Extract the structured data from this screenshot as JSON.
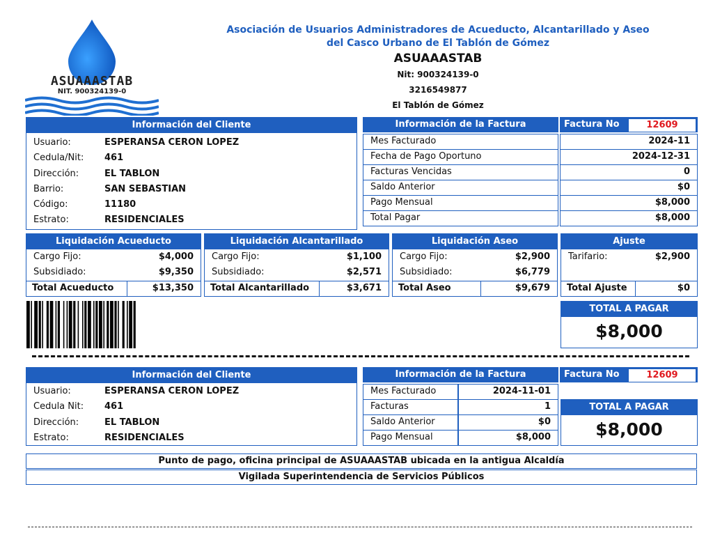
{
  "logo": {
    "name": "ASUAAASTAB",
    "nit": "NIT. 900324139-0"
  },
  "header": {
    "line1": "Asociación de Usuarios Administradores de Acueducto, Alcantarillado y Aseo",
    "line2": "del Casco Urbano de El Tablón de Gómez",
    "name": "ASUAAASTAB",
    "nit": "Nit: 900324139-0",
    "phone": "3216549877",
    "city": "El Tablón de Gómez"
  },
  "client": {
    "title": "Información del Cliente",
    "rows": [
      {
        "k": "Usuario:",
        "v": "ESPERANSA CERON LOPEZ"
      },
      {
        "k": "Cedula/Nit:",
        "v": "461"
      },
      {
        "k": "Dirección:",
        "v": "EL TABLON"
      },
      {
        "k": "Barrio:",
        "v": "SAN SEBASTIAN"
      },
      {
        "k": "Código:",
        "v": "11180"
      },
      {
        "k": "Estrato:",
        "v": "RESIDENCIALES"
      }
    ]
  },
  "invoice": {
    "title": "Información de la Factura",
    "no_label": "Factura No",
    "no_value": "12609",
    "rows": [
      {
        "k": "Mes Facturado",
        "v": "2024-11"
      },
      {
        "k": "Fecha de Pago Oportuno",
        "v": "2024-12-31"
      },
      {
        "k": "Facturas Vencidas",
        "v": "0"
      },
      {
        "k": "Saldo Anterior",
        "v": "$0"
      },
      {
        "k": "Pago Mensual",
        "v": "$8,000"
      },
      {
        "k": "Total Pagar",
        "v": "$8,000"
      }
    ]
  },
  "liq": [
    {
      "title": "Liquidación Acueducto",
      "rows": [
        {
          "k": "Cargo Fijo:",
          "v": "$4,000"
        },
        {
          "k": "Subsidiado:",
          "v": "$9,350"
        }
      ],
      "total_k": "Total Acueducto",
      "total_v": "$13,350"
    },
    {
      "title": "Liquidación Alcantarillado",
      "rows": [
        {
          "k": "Cargo Fijo:",
          "v": "$1,100"
        },
        {
          "k": "Subsidiado:",
          "v": "$2,571"
        }
      ],
      "total_k": "Total Alcantarillado",
      "total_v": "$3,671"
    },
    {
      "title": "Liquidación Aseo",
      "rows": [
        {
          "k": "Cargo Fijo:",
          "v": "$2,900"
        },
        {
          "k": "Subsidiado:",
          "v": "$6,779"
        }
      ],
      "total_k": "Total Aseo",
      "total_v": "$9,679"
    },
    {
      "title": "Ajuste",
      "rows": [
        {
          "k": "Tarifario:",
          "v": "$2,900"
        }
      ],
      "total_k": "Total Ajuste",
      "total_v": "$0"
    }
  ],
  "total": {
    "label": "TOTAL A PAGAR",
    "value": "$8,000"
  },
  "stub": {
    "client_title": "Información del Cliente",
    "client_rows": [
      {
        "k": "Usuario:",
        "v": "ESPERANSA CERON LOPEZ"
      },
      {
        "k": "Cedula Nit:",
        "v": "461"
      },
      {
        "k": "Dirección:",
        "v": "EL TABLON"
      },
      {
        "k": "Estrato:",
        "v": "RESIDENCIALES"
      }
    ],
    "invoice_title": "Información de la Factura",
    "no_label": "Factura No",
    "no_value": "12609",
    "invoice_rows": [
      {
        "k": "Mes Facturado",
        "v": "2024-11-01"
      },
      {
        "k": "Facturas Vencidas",
        "v": "1"
      },
      {
        "k": "Saldo Anterior",
        "v": "$0"
      },
      {
        "k": "Pago Mensual",
        "v": "$8,000"
      }
    ],
    "total_label": "TOTAL A PAGAR",
    "total_value": "$8,000"
  },
  "footer": {
    "line1": "Punto de pago, oficina principal de ASUAAASTAB ubicada en la antigua Alcaldía",
    "line2": "Vigilada Superintendencia de Servicios Públicos"
  },
  "colors": {
    "accent": "#1f5fbf",
    "invoice_no": "#e0191f"
  }
}
